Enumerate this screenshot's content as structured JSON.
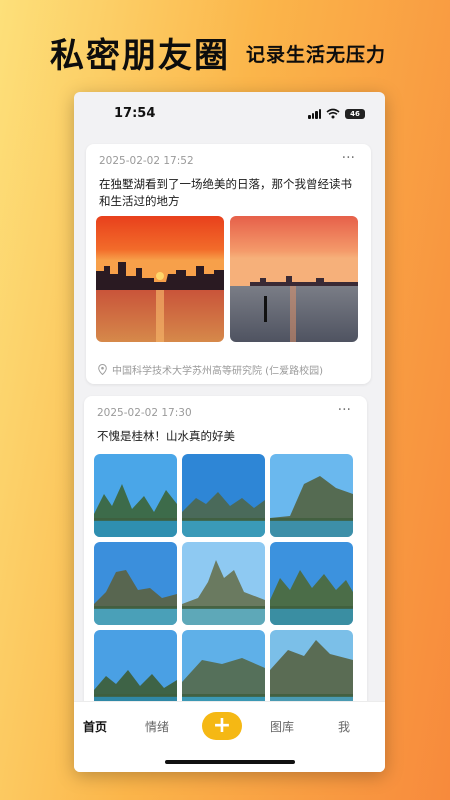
{
  "promo": {
    "title": "私密朋友圈",
    "subtitle": "记录生活无压力"
  },
  "status_bar": {
    "time": "17:54",
    "battery": "46",
    "icons": [
      "signal-icon",
      "wifi-icon",
      "battery-icon"
    ]
  },
  "posts": [
    {
      "timestamp": "2025-02-02 17:52",
      "more": "···",
      "text": "在独墅湖看到了一场绝美的日落，那个我曾经读书和生活过的地方",
      "photos": [
        "sunset-city-photo",
        "sunset-lake-photo"
      ],
      "location": "中国科学技术大学苏州高等研究院 (仁爱路校园)"
    },
    {
      "timestamp": "2025-02-02 17:30",
      "more": "···",
      "text": "不愧是桂林！山水真的好美",
      "photos": [
        "guilin-photo-1",
        "guilin-photo-2",
        "guilin-photo-3",
        "guilin-photo-4",
        "guilin-photo-5",
        "guilin-photo-6",
        "guilin-photo-7",
        "guilin-photo-8",
        "guilin-photo-9"
      ]
    }
  ],
  "tabbar": {
    "home": "首页",
    "mood": "情绪",
    "add": "+",
    "gallery": "图库",
    "me": "我"
  },
  "colors": {
    "accent": "#f5b814",
    "background_left": "#fde07a",
    "background_right": "#f78a3c"
  }
}
